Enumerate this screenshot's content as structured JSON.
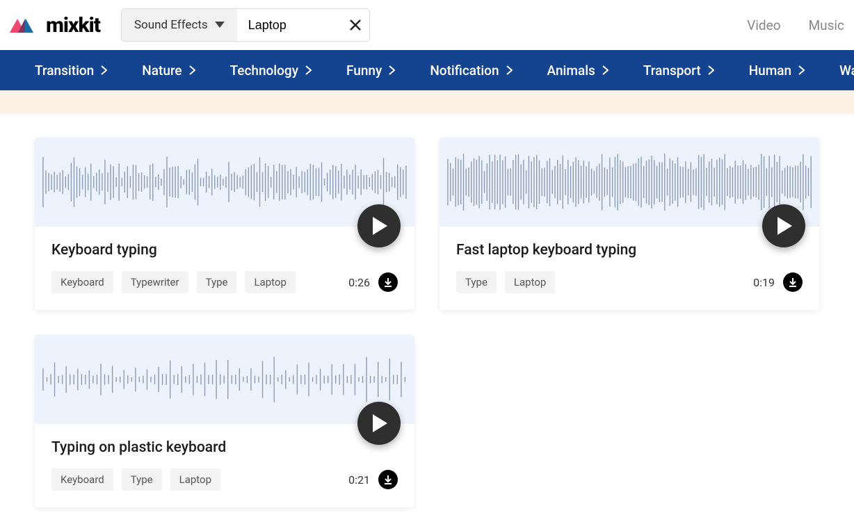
{
  "header": {
    "logo_text": "mixkit",
    "search_category": "Sound Effects",
    "search_value": "Laptop",
    "nav": [
      "Video",
      "Music"
    ]
  },
  "categories": [
    "Transition",
    "Nature",
    "Technology",
    "Funny",
    "Notification",
    "Animals",
    "Transport",
    "Human",
    "Warfare"
  ],
  "cards": [
    {
      "title": "Keyboard typing",
      "tags": [
        "Keyboard",
        "Typewriter",
        "Type",
        "Laptop"
      ],
      "duration": "0:26",
      "wave_style": "soft"
    },
    {
      "title": "Fast laptop keyboard typing",
      "tags": [
        "Type",
        "Laptop"
      ],
      "duration": "0:19",
      "wave_style": "dense"
    },
    {
      "title": "Typing on plastic keyboard",
      "tags": [
        "Keyboard",
        "Type",
        "Laptop"
      ],
      "duration": "0:21",
      "wave_style": "sparse"
    }
  ]
}
